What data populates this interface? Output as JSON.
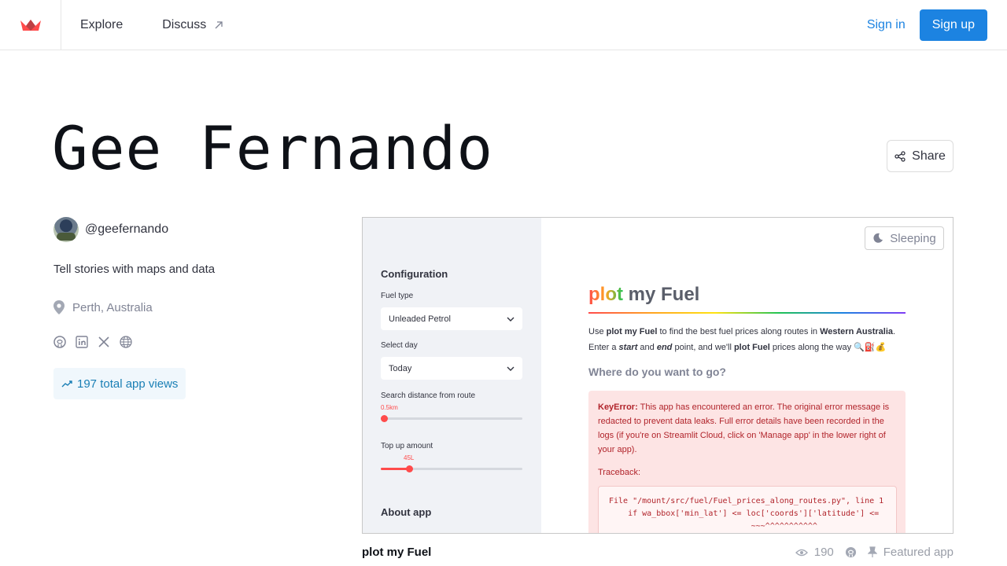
{
  "nav": {
    "explore": "Explore",
    "discuss": "Discuss",
    "signin": "Sign in",
    "signup": "Sign up"
  },
  "profile": {
    "name": "Gee Fernando",
    "handle": "@geefernando",
    "bio": "Tell stories with maps and data",
    "location": "Perth, Australia",
    "views": "197 total app views",
    "share": "Share",
    "social_icons": [
      "github-icon",
      "linkedin-icon",
      "x-icon",
      "globe-icon"
    ]
  },
  "preview": {
    "status": "Sleeping",
    "sidebar": {
      "configuration": "Configuration",
      "fuel_type_label": "Fuel type",
      "fuel_type_value": "Unleaded Petrol",
      "select_day_label": "Select day",
      "select_day_value": "Today",
      "search_distance_label": "Search distance from route",
      "search_distance_value": "0.5km",
      "topup_label": "Top up amount",
      "topup_value": "45L",
      "about": "About app"
    },
    "title_plot": "plot",
    "title_rest": " my Fuel",
    "intro_line1_a": "Use ",
    "intro_line1_b": "plot my Fuel",
    "intro_line1_c": " to find the best fuel prices along routes in ",
    "intro_line1_d": "Western Australia",
    "intro_line1_e": ".",
    "intro_line2_a": "Enter a ",
    "intro_line2_b": "start",
    "intro_line2_c": " and ",
    "intro_line2_d": "end",
    "intro_line2_e": " point, and we'll ",
    "intro_line2_f": "plot Fuel",
    "intro_line2_g": " prices along the way 🔍⛽💰",
    "subheading": "Where do you want to go?",
    "error_label": "KeyError:",
    "error_text": " This app has encountered an error. The original error message is redacted to prevent data leaks. Full error details have been recorded in the logs (if you're on Streamlit Cloud, click on 'Manage app' in the lower right of your app).",
    "traceback": "Traceback:",
    "code_line1": "File \"/mount/src/fuel/Fuel_prices_along_routes.py\", line 1",
    "code_line2": "    if wa_bbox['min_lat'] <= loc['coords']['latitude'] <=",
    "code_line3": "                              ~~~^^^^^^^^^^^"
  },
  "footer": {
    "app_name": "plot my Fuel",
    "view_count": "190",
    "featured": "Featured app"
  },
  "colors": {
    "accent": "#1c83e1",
    "error_bg": "#fde4e4",
    "error_text": "#b1242b",
    "slider": "#ff4b4b"
  },
  "slider_levels": {
    "search_distance_fraction": 0.02,
    "topup_fraction": 0.2
  }
}
